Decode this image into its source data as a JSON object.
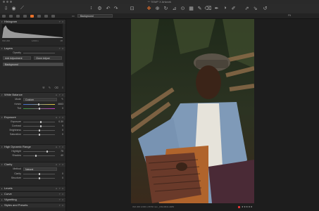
{
  "window": {
    "title": "** TEMP X Artwork"
  },
  "toolbar": {
    "left_icons": [
      "import-icon",
      "capture-icon",
      "browser-icon"
    ],
    "center_icons": [
      "move-icon",
      "sync-icon",
      "rotate-left-icon",
      "rotate-right-icon",
      "crop-icon"
    ],
    "tool_icons": [
      "pan-icon",
      "zoom-icon",
      "rotate-tool-icon",
      "keystone-icon",
      "spot-icon",
      "mask-icon",
      "picker-icon",
      "erase-icon",
      "pen-icon",
      "gradient-icon",
      "annotate-icon",
      "styles-icon"
    ],
    "right_icons": [
      "copy-adjustments-icon",
      "apply-adjustments-icon",
      "reset-icon"
    ]
  },
  "subbar": {
    "variant_select": "Background",
    "fit_label": "Fit"
  },
  "panel": {
    "histogram": {
      "title": "Histogram",
      "iso": "ISO 200",
      "shutter": "1/200 s",
      "aperture": "f/8"
    },
    "layers": {
      "title": "Layers",
      "opacity_label": "Opacity",
      "add_label": "Add Adjustment",
      "clone_label": "Clone Adjust",
      "background_label": "Background"
    },
    "white_balance": {
      "title": "White Balance",
      "mode_label": "Mode",
      "mode_value": "Custom",
      "kelvin_label": "Kelvin",
      "kelvin_value": "4663",
      "tint_label": "Tint",
      "tint_value": "0"
    },
    "exposure": {
      "title": "Exposure",
      "rows": [
        {
          "label": "Exposure",
          "value": "0.30",
          "pos": 0.55
        },
        {
          "label": "Contrast",
          "value": "9",
          "pos": 0.56
        },
        {
          "label": "Brightness",
          "value": "0",
          "pos": 0.5
        },
        {
          "label": "Saturation",
          "value": "0",
          "pos": 0.5
        }
      ]
    },
    "hdr": {
      "title": "High Dynamic Range",
      "rows": [
        {
          "label": "Highlight",
          "value": "75",
          "pos": 0.75
        },
        {
          "label": "Shadow",
          "value": "40",
          "pos": 0.4
        }
      ]
    },
    "clarity": {
      "title": "Clarity",
      "method_label": "Method",
      "method_value": "Natural",
      "rows": [
        {
          "label": "Clarity",
          "value": "0",
          "pos": 0.5
        },
        {
          "label": "Structure",
          "value": "0",
          "pos": 0.5
        }
      ]
    },
    "collapsed": [
      "Levels",
      "Curve",
      "Vignetting",
      "Styles and Presets"
    ]
  },
  "infobar": {
    "left": "ISO 200   1/200 s   f/8   50 mm   _DSC0641.ARW",
    "stars": "★★★★★"
  },
  "colors": {
    "accent": "#e8702a",
    "rating_red": "#d33333"
  }
}
